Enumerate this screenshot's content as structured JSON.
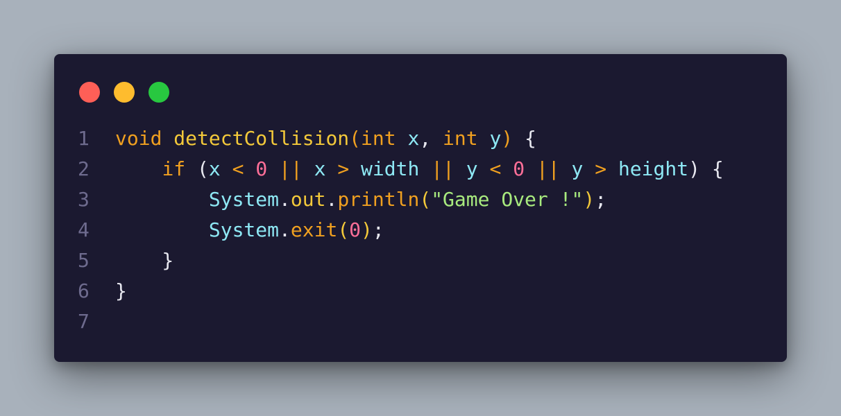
{
  "window": {
    "traffic_lights": [
      {
        "name": "close",
        "color": "#fe5f57"
      },
      {
        "name": "minimize",
        "color": "#febc2e"
      },
      {
        "name": "maximize",
        "color": "#28c840"
      }
    ]
  },
  "colors": {
    "background": "#a8b1bb",
    "editor": "#1b1930",
    "line_number": "#6e6b8e",
    "keyword": "#f0a020",
    "function": "#f3c93a",
    "variable": "#8ee8f4",
    "punctuation": "#e8e8f0",
    "number": "#ff6f98",
    "string": "#a8ea7e"
  },
  "code": {
    "lines": [
      {
        "number": "1",
        "tokens": [
          {
            "text": "void",
            "type": "kw"
          },
          {
            "text": " ",
            "type": "punc"
          },
          {
            "text": "detectCollision",
            "type": "fn"
          },
          {
            "text": "(",
            "type": "kw"
          },
          {
            "text": "int",
            "type": "kw"
          },
          {
            "text": " ",
            "type": "punc"
          },
          {
            "text": "x",
            "type": "var"
          },
          {
            "text": ", ",
            "type": "punc"
          },
          {
            "text": "int",
            "type": "kw"
          },
          {
            "text": " ",
            "type": "punc"
          },
          {
            "text": "y",
            "type": "var"
          },
          {
            "text": ")",
            "type": "kw"
          },
          {
            "text": " {",
            "type": "punc"
          }
        ]
      },
      {
        "number": "2",
        "tokens": [
          {
            "text": "    ",
            "type": "punc"
          },
          {
            "text": "if",
            "type": "kw"
          },
          {
            "text": " (",
            "type": "punc"
          },
          {
            "text": "x",
            "type": "var"
          },
          {
            "text": " ",
            "type": "punc"
          },
          {
            "text": "<",
            "type": "op"
          },
          {
            "text": " ",
            "type": "punc"
          },
          {
            "text": "0",
            "type": "num"
          },
          {
            "text": " ",
            "type": "punc"
          },
          {
            "text": "||",
            "type": "op"
          },
          {
            "text": " ",
            "type": "punc"
          },
          {
            "text": "x",
            "type": "var"
          },
          {
            "text": " ",
            "type": "punc"
          },
          {
            "text": ">",
            "type": "op"
          },
          {
            "text": " ",
            "type": "punc"
          },
          {
            "text": "width",
            "type": "var"
          },
          {
            "text": " ",
            "type": "punc"
          },
          {
            "text": "||",
            "type": "op"
          },
          {
            "text": " ",
            "type": "punc"
          },
          {
            "text": "y",
            "type": "var"
          },
          {
            "text": " ",
            "type": "punc"
          },
          {
            "text": "<",
            "type": "op"
          },
          {
            "text": " ",
            "type": "punc"
          },
          {
            "text": "0",
            "type": "num"
          },
          {
            "text": " ",
            "type": "punc"
          },
          {
            "text": "||",
            "type": "op"
          },
          {
            "text": " ",
            "type": "punc"
          },
          {
            "text": "y",
            "type": "var"
          },
          {
            "text": " ",
            "type": "punc"
          },
          {
            "text": ">",
            "type": "op"
          },
          {
            "text": " ",
            "type": "punc"
          },
          {
            "text": "height",
            "type": "var"
          },
          {
            "text": ") {",
            "type": "punc"
          }
        ]
      },
      {
        "number": "3",
        "tokens": [
          {
            "text": "        ",
            "type": "punc"
          },
          {
            "text": "System",
            "type": "var"
          },
          {
            "text": ".",
            "type": "punc"
          },
          {
            "text": "out",
            "type": "fn"
          },
          {
            "text": ".",
            "type": "punc"
          },
          {
            "text": "println",
            "type": "kw"
          },
          {
            "text": "(",
            "type": "fn"
          },
          {
            "text": "\"Game Over !\"",
            "type": "str"
          },
          {
            "text": ")",
            "type": "fn"
          },
          {
            "text": ";",
            "type": "punc"
          }
        ]
      },
      {
        "number": "4",
        "tokens": [
          {
            "text": "        ",
            "type": "punc"
          },
          {
            "text": "System",
            "type": "var"
          },
          {
            "text": ".",
            "type": "punc"
          },
          {
            "text": "exit",
            "type": "kw"
          },
          {
            "text": "(",
            "type": "fn"
          },
          {
            "text": "0",
            "type": "num"
          },
          {
            "text": ")",
            "type": "fn"
          },
          {
            "text": ";",
            "type": "punc"
          }
        ]
      },
      {
        "number": "5",
        "tokens": [
          {
            "text": "    }",
            "type": "punc"
          }
        ]
      },
      {
        "number": "6",
        "tokens": [
          {
            "text": "}",
            "type": "punc"
          }
        ]
      },
      {
        "number": "7",
        "tokens": []
      }
    ]
  }
}
